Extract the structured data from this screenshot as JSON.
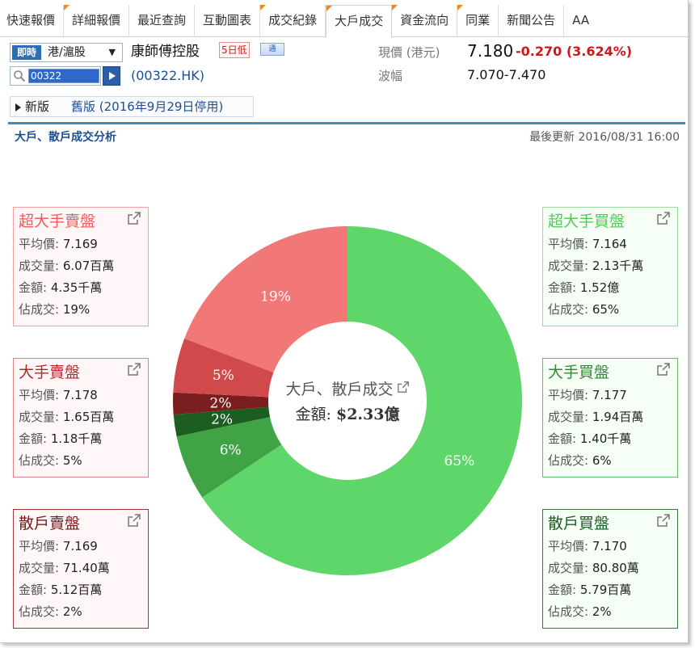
{
  "tabs": [
    {
      "label": "快速報價",
      "corner": false,
      "active": false
    },
    {
      "label": "詳細報價",
      "corner": true,
      "active": false
    },
    {
      "label": "最近查詢",
      "corner": false,
      "active": false
    },
    {
      "label": "互動圖表",
      "corner": false,
      "active": false
    },
    {
      "label": "成交紀錄",
      "corner": true,
      "active": false
    },
    {
      "label": "大戶成交",
      "corner": true,
      "active": true
    },
    {
      "label": "資金流向",
      "corner": true,
      "active": false
    },
    {
      "label": "同業",
      "corner": true,
      "active": false
    },
    {
      "label": "新聞公告",
      "corner": false,
      "active": false
    },
    {
      "label": "AA",
      "corner": false,
      "active": false
    }
  ],
  "header": {
    "mode_badge": "即時",
    "market": "港/滬股",
    "search_value": "00322",
    "stock_name": "康師傅控股",
    "tag_5day": "5日低",
    "tag_pic": "通",
    "stock_code": "(00322.HK)",
    "price_label": "現價 (港元)",
    "price": "7.180",
    "change": "-0.270 (3.624%)",
    "range_label": "波幅",
    "range": "7.070-7.470"
  },
  "version": {
    "new_label": "新版",
    "old_label": "舊版 (2016年9月29日停用)"
  },
  "section": {
    "title": "大戶、散戶成交分析",
    "updated": "最後更新 2016/08/31 16:00"
  },
  "field_labels": {
    "avg": "平均價:",
    "vol": "成交量:",
    "amt": "金額:",
    "pct": "佔成交:"
  },
  "cards": {
    "sell1": {
      "title": "超大手賣盤",
      "avg": "7.169",
      "vol": "6.07百萬",
      "amt": "4.35千萬",
      "pct": "19%"
    },
    "sell2": {
      "title": "大手賣盤",
      "avg": "7.178",
      "vol": "1.65百萬",
      "amt": "1.18千萬",
      "pct": "5%"
    },
    "sell3": {
      "title": "散戶賣盤",
      "avg": "7.169",
      "vol": "71.40萬",
      "amt": "5.12百萬",
      "pct": "2%"
    },
    "buy1": {
      "title": "超大手買盤",
      "avg": "7.164",
      "vol": "2.13千萬",
      "amt": "1.52億",
      "pct": "65%"
    },
    "buy2": {
      "title": "大手買盤",
      "avg": "7.177",
      "vol": "1.94百萬",
      "amt": "1.40千萬",
      "pct": "6%"
    },
    "buy3": {
      "title": "散戶買盤",
      "avg": "7.170",
      "vol": "80.80萬",
      "amt": "5.79百萬",
      "pct": "2%"
    }
  },
  "center": {
    "title": "大戶、散戶成交",
    "amount_label": "金額:",
    "amount_value": "$2.33億"
  },
  "chart_data": {
    "type": "pie",
    "title": "",
    "slices": [
      {
        "label": "超大手買盤",
        "value": 65,
        "text": "65%",
        "color": "#5fd66a"
      },
      {
        "label": "大手買盤",
        "value": 6,
        "text": "6%",
        "color": "#40a446"
      },
      {
        "label": "散戶買盤",
        "value": 2,
        "text": "2%",
        "color": "#1c5e22"
      },
      {
        "label": "散戶賣盤",
        "value": 2,
        "text": "2%",
        "color": "#7a1e20"
      },
      {
        "label": "大手賣盤",
        "value": 5,
        "text": "5%",
        "color": "#d04a4c"
      },
      {
        "label": "超大手賣盤",
        "value": 19,
        "text": "19%",
        "color": "#f27878"
      }
    ]
  },
  "colors": {
    "accent_blue": "#1d4f91",
    "down_red": "#d01818",
    "tab_corner": "#f08a1e"
  }
}
